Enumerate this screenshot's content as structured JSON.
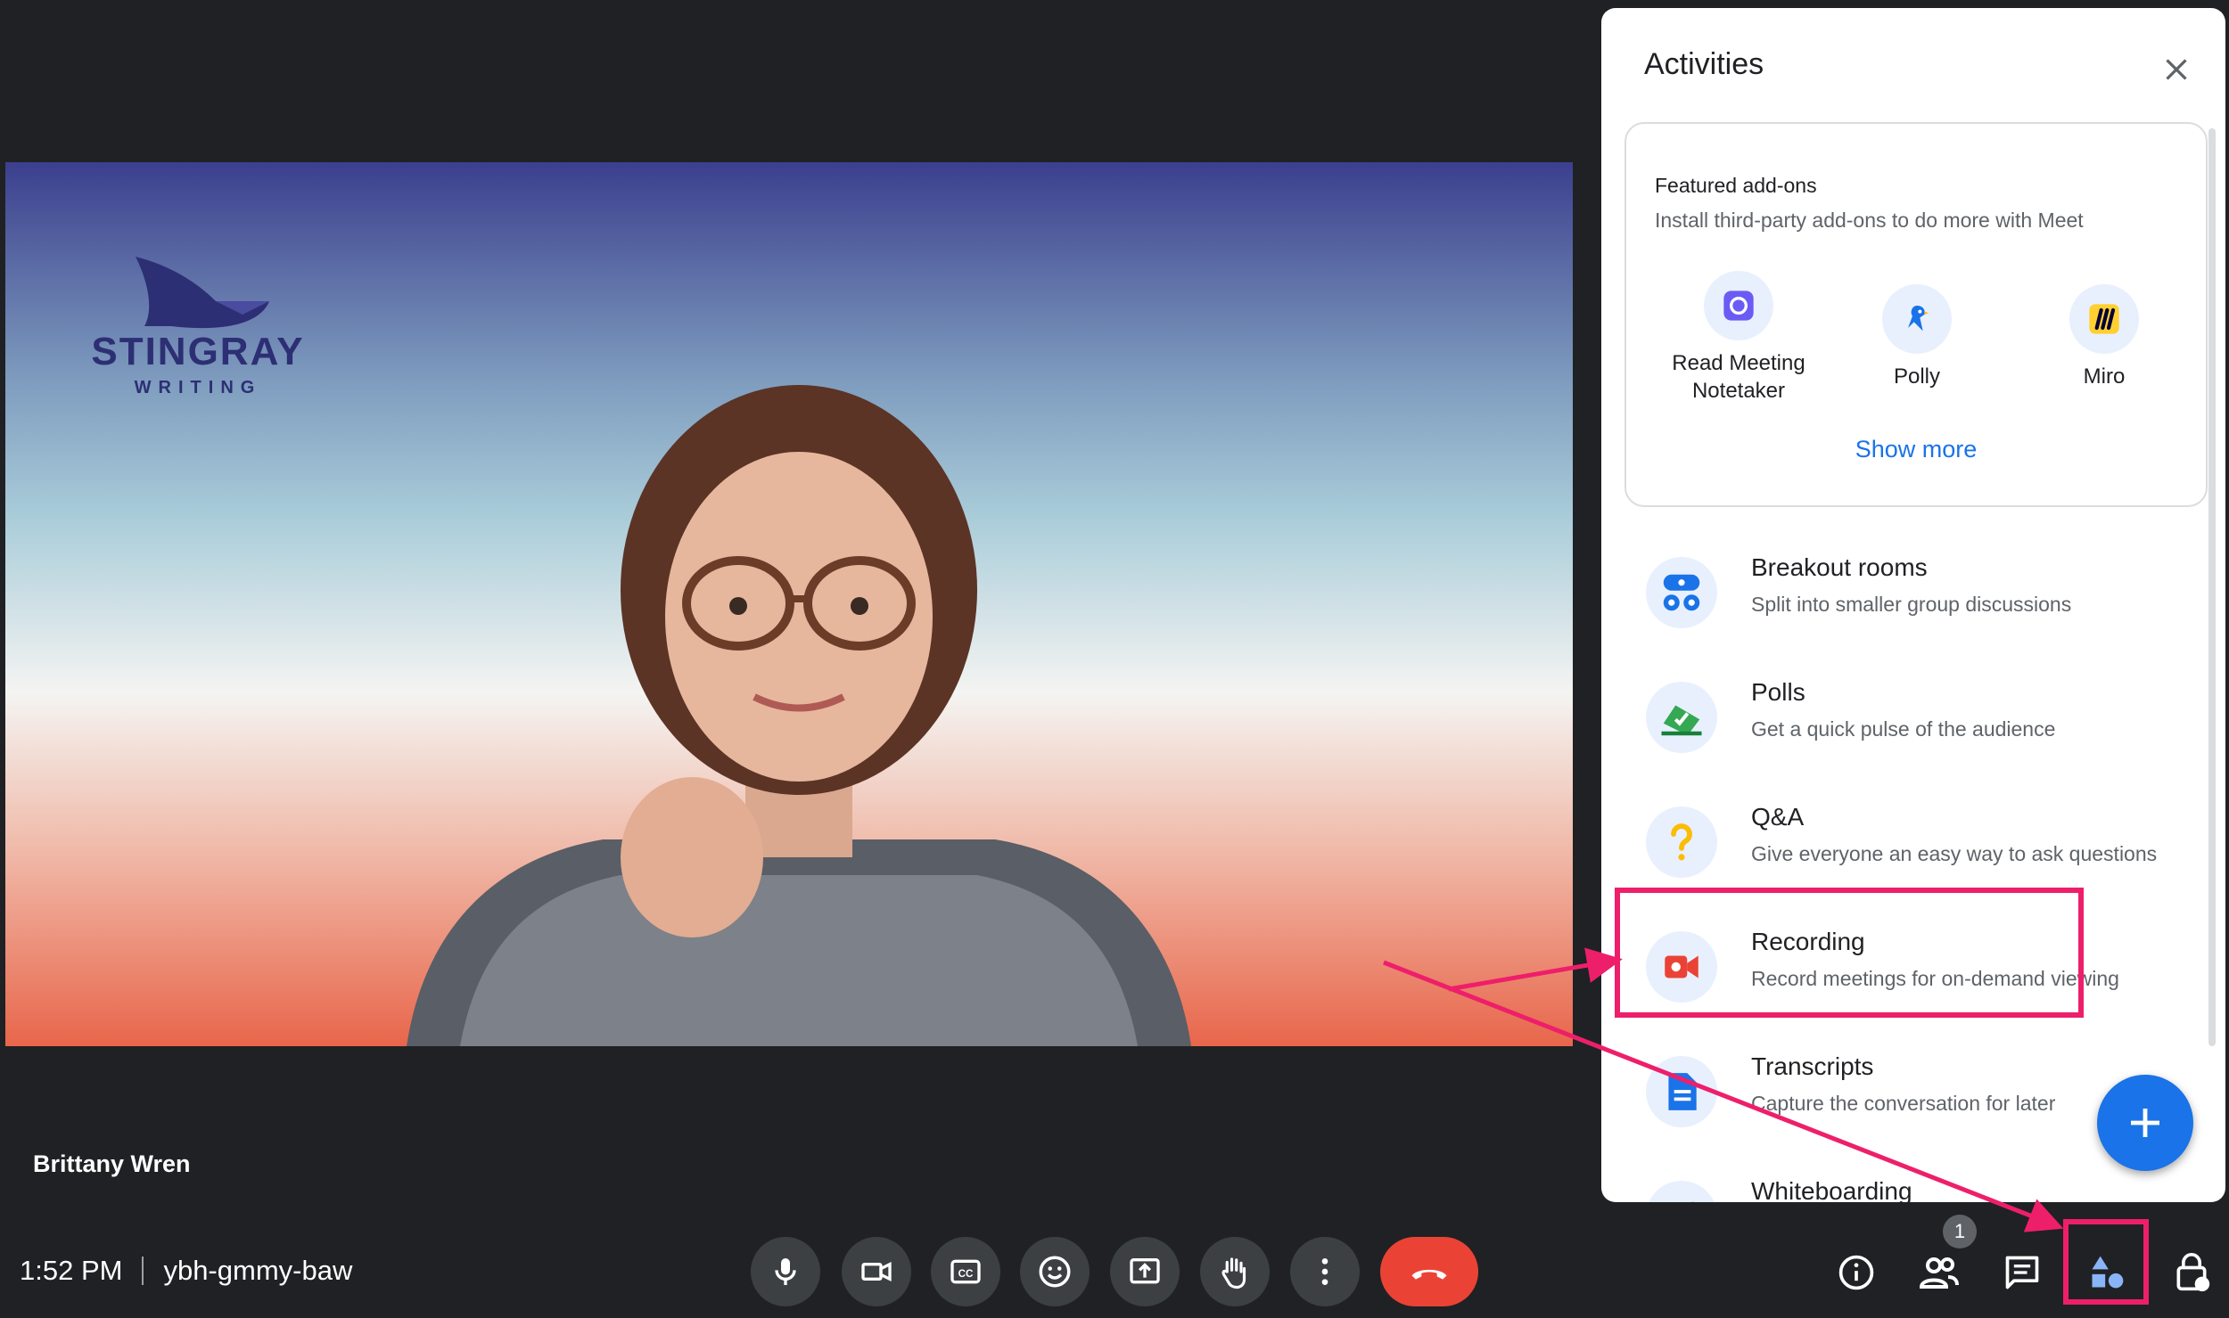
{
  "video": {
    "logo_word": "STINGRAY",
    "logo_sub": "WRITING",
    "participant_name": "Brittany Wren"
  },
  "meeting": {
    "time": "1:52 PM",
    "code": "ybh-gmmy-baw",
    "people_count": "1"
  },
  "controls": {
    "mic_icon": "microphone-icon",
    "camera_icon": "camera-icon",
    "captions_icon": "closed-captions-icon",
    "emoji_icon": "emoji-icon",
    "present_icon": "present-screen-icon",
    "hand_icon": "raise-hand-icon",
    "more_icon": "more-options-icon",
    "hangup_icon": "hang-up-icon"
  },
  "right_controls": [
    "info-icon",
    "people-icon",
    "chat-icon",
    "activities-icon",
    "host-controls-icon"
  ],
  "panel": {
    "title": "Activities",
    "featured": {
      "title": "Featured add-ons",
      "subtitle": "Install third-party add-ons to do more with Meet",
      "items": [
        {
          "label_line1": "Read Meeting",
          "label_line2": "Notetaker"
        },
        {
          "label_line1": "Polly",
          "label_line2": ""
        },
        {
          "label_line1": "Miro",
          "label_line2": ""
        }
      ],
      "show_more": "Show more"
    },
    "activities": [
      {
        "title": "Breakout rooms",
        "subtitle": "Split into smaller group discussions"
      },
      {
        "title": "Polls",
        "subtitle": "Get a quick pulse of the audience"
      },
      {
        "title": "Q&A",
        "subtitle": "Give everyone an easy way to ask questions"
      },
      {
        "title": "Recording",
        "subtitle": "Record meetings for on-demand viewing"
      },
      {
        "title": "Transcripts",
        "subtitle": "Capture the conversation for later"
      },
      {
        "title": "Whiteboarding",
        "subtitle": ""
      }
    ]
  },
  "colors": {
    "accent": "#1a73e8",
    "hangup": "#ea4335",
    "highlight": "#ee1f6a",
    "background": "#202124"
  }
}
